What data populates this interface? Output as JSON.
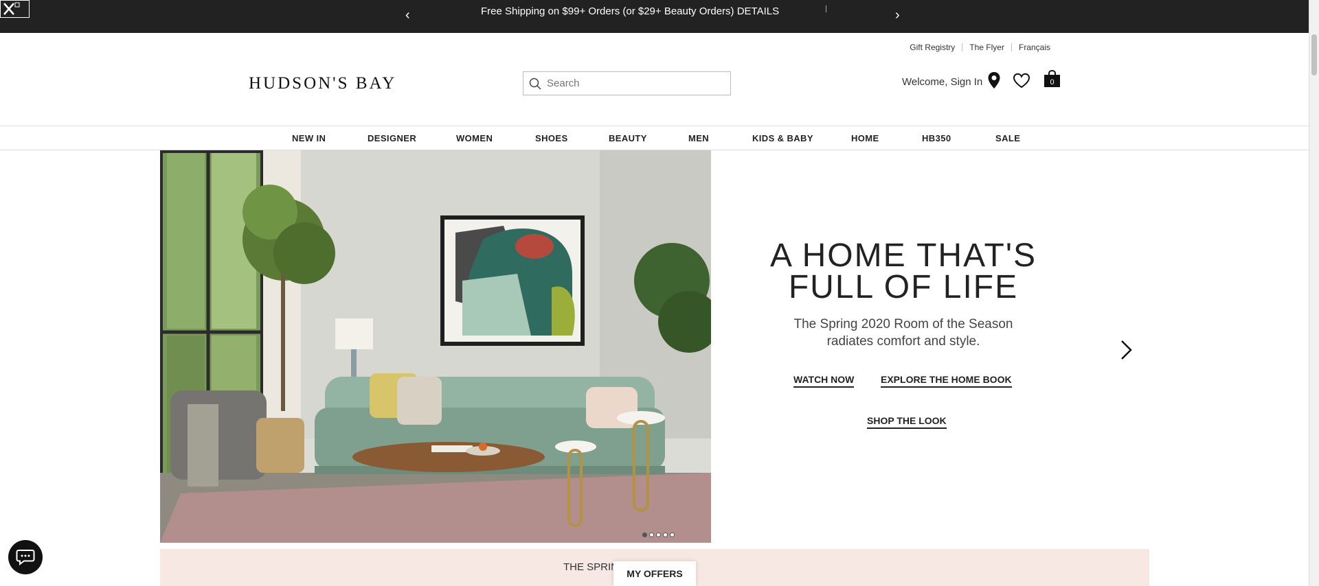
{
  "promo": {
    "message": "Free Shipping on $99+ Orders (or $29+ Beauty Orders) DETAILS",
    "prev_arrow": "‹",
    "next_arrow": "›"
  },
  "utility_links": [
    "Gift Registry",
    "The Flyer",
    "Français"
  ],
  "header": {
    "logo": "HUDSON'S BAY",
    "search_placeholder": "Search",
    "welcome": "Welcome, Sign In",
    "cart_count": "0"
  },
  "nav": [
    "NEW IN",
    "DESIGNER",
    "WOMEN",
    "SHOES",
    "BEAUTY",
    "MEN",
    "KIDS & BABY",
    "HOME",
    "HB350",
    "SALE"
  ],
  "hero": {
    "title_line1": "A HOME THAT'S",
    "title_line2": "FULL OF LIFE",
    "subtitle_line1": "The Spring 2020 Room of the Season",
    "subtitle_line2": "radiates comfort and style.",
    "cta_watch": "WATCH NOW",
    "cta_explore": "EXPLORE THE HOME BOOK",
    "cta_shop": "SHOP THE LOOK",
    "slide_count": 5,
    "active_slide": 1
  },
  "banner": {
    "text": "THE SPRING                    TO 50% OFF",
    "my_offers": "MY OFFERS"
  },
  "colors": {
    "promo_bg": "#222222",
    "banner_bg": "#f7e8e3"
  }
}
